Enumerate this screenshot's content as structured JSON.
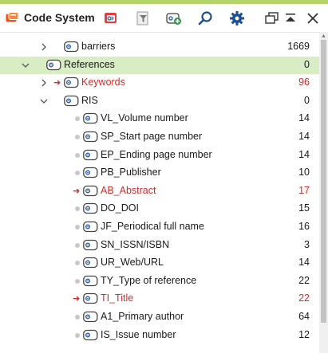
{
  "window": {
    "title": "Code System"
  },
  "colors": {
    "accent_stripe": "#b5d36b",
    "selected_row": "#d8edc4",
    "red_text": "#d12b2b"
  },
  "toolbar": {
    "buttons": [
      {
        "name": "new-code-icon"
      },
      {
        "name": "filter-icon"
      },
      {
        "name": "add-code-icon"
      },
      {
        "name": "search-icon"
      },
      {
        "name": "gear-icon"
      },
      {
        "name": "undock-icon"
      },
      {
        "name": "collapse-up-icon"
      },
      {
        "name": "close-icon"
      }
    ]
  },
  "tree": {
    "rows": [
      {
        "label": "barriers",
        "count": "1669"
      },
      {
        "label": "References",
        "count": "0"
      },
      {
        "label": "Keywords",
        "count": "96"
      },
      {
        "label": "RIS",
        "count": "0"
      },
      {
        "label": "VL_Volume number",
        "count": "14"
      },
      {
        "label": "SP_Start page number",
        "count": "14"
      },
      {
        "label": "EP_Ending page number",
        "count": "14"
      },
      {
        "label": "PB_Publisher",
        "count": "10"
      },
      {
        "label": "AB_Abstract",
        "count": "17"
      },
      {
        "label": "DO_DOI",
        "count": "15"
      },
      {
        "label": "JF_Periodical full name",
        "count": "16"
      },
      {
        "label": "SN_ISSN/ISBN",
        "count": "3"
      },
      {
        "label": "UR_Web/URL",
        "count": "14"
      },
      {
        "label": "TY_Type of reference",
        "count": "22"
      },
      {
        "label": "TI_Title",
        "count": "22"
      },
      {
        "label": "A1_Primary author",
        "count": "64"
      },
      {
        "label": "IS_Issue number",
        "count": "12"
      }
    ]
  }
}
